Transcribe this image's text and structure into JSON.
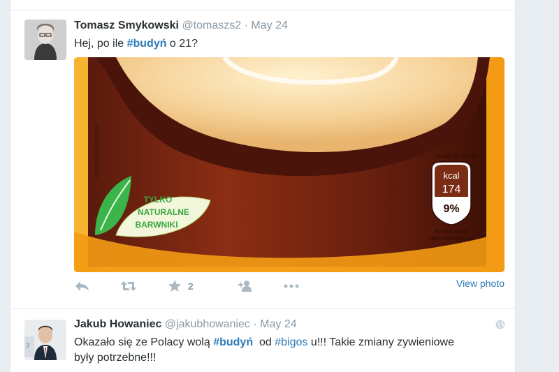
{
  "tweets": [
    {
      "fullname": "Tomasz Smykowski",
      "username": "@tomaszs2",
      "separator": "·",
      "time": "May 24",
      "text_before": "Hej, po ile ",
      "hashtag": "#budyń",
      "text_after": " o 21?",
      "media": {
        "side_text": "propozycja podania",
        "badge_lines": [
          "TYLKO",
          "NATURALNE",
          "BARWNIKI"
        ],
        "portion_label": "1 porcja (ok. 214 g)",
        "kcal_label": "kcal",
        "kcal_value": "174",
        "percent": "9%",
        "daily_note_1": "% wskazanego",
        "daily_note_2": "dziennego spożycia"
      },
      "actions": {
        "favorite_count": "2"
      },
      "view_photo": "View photo"
    },
    {
      "fullname": "Jakub Howaniec",
      "username": "@jakubhowaniec",
      "separator": "·",
      "time": "May 24",
      "line1_part1": "Okazało się ze Polacy wolą ",
      "hashtag1": "#budyń",
      "line1_part2": "  od ",
      "hashtag2": "#bigos",
      "line1_part3": " u!!! Takie zmiany zywieniowe",
      "line2": "były potrzebne!!!"
    }
  ],
  "colors": {
    "link": "#2b7bb9",
    "meta": "#8899a6",
    "action": "#aab8c2",
    "text": "#292f33"
  }
}
